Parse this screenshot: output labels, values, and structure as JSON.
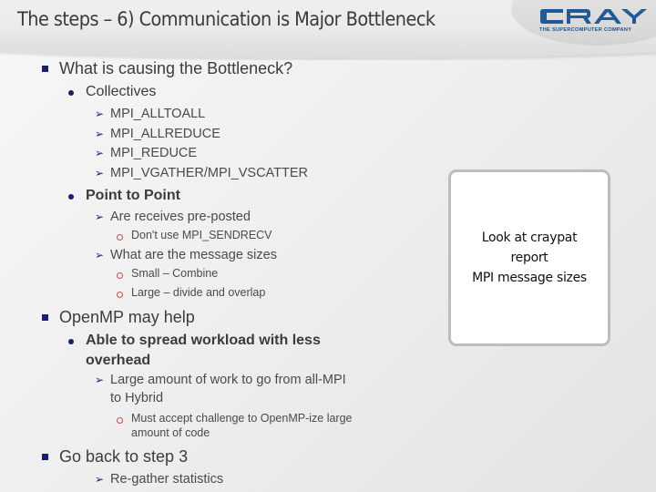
{
  "slide": {
    "title": "The steps – 6) Communication is Major Bottleneck",
    "logo": {
      "icon": "cray-logo",
      "wordmark": "CRAY",
      "tagline": "THE SUPERCOMPUTER COMPANY",
      "brand_color": "#1f5b9a"
    },
    "bullets": [
      {
        "level": 1,
        "bullet": "square",
        "text": "What is causing the Bottleneck?"
      },
      {
        "level": 2,
        "bullet": "dot",
        "text": "Collectives"
      },
      {
        "level": 3,
        "bullet": "arrow",
        "text": "MPI_ALLTOALL"
      },
      {
        "level": 3,
        "bullet": "arrow",
        "text": "MPI_ALLREDUCE"
      },
      {
        "level": 3,
        "bullet": "arrow",
        "text": "MPI_REDUCE"
      },
      {
        "level": 3,
        "bullet": "arrow",
        "text": "MPI_VGATHER/MPI_VSCATTER"
      },
      {
        "level": 2,
        "bullet": "dot",
        "text": "Point to Point"
      },
      {
        "level": 3,
        "bullet": "arrow",
        "text": "Are receives pre-posted"
      },
      {
        "level": 4,
        "bullet": "ring",
        "text": "Don't use MPI_SENDRECV"
      },
      {
        "level": 3,
        "bullet": "arrow",
        "text": "What are the message sizes"
      },
      {
        "level": 4,
        "bullet": "ring",
        "text": "Small – Combine"
      },
      {
        "level": 4,
        "bullet": "ring",
        "text": "Large – divide and overlap"
      },
      {
        "level": 1,
        "bullet": "square",
        "text": "OpenMP may help"
      },
      {
        "level": 2,
        "bullet": "dot",
        "text": "Able to spread workload with less",
        "continuation": "overhead"
      },
      {
        "level": 3,
        "bullet": "arrow",
        "text": "Large amount of work to go from all-MPI",
        "continuation": "to Hybrid"
      },
      {
        "level": 4,
        "bullet": "ring",
        "text": "Must accept challenge to OpenMP-ize large",
        "continuation": "amount of code"
      },
      {
        "level": 1,
        "bullet": "square",
        "text": "Go back to step 3"
      },
      {
        "level": 3,
        "bullet": "arrow",
        "text": "Re-gather statistics"
      }
    ],
    "callout": {
      "lines": [
        "Look at craypat",
        "report",
        "MPI message sizes"
      ]
    },
    "colors": {
      "bullet_navy": "#1a1f6e",
      "ring_red": "#c0504d",
      "text_gray": "#444444"
    }
  }
}
